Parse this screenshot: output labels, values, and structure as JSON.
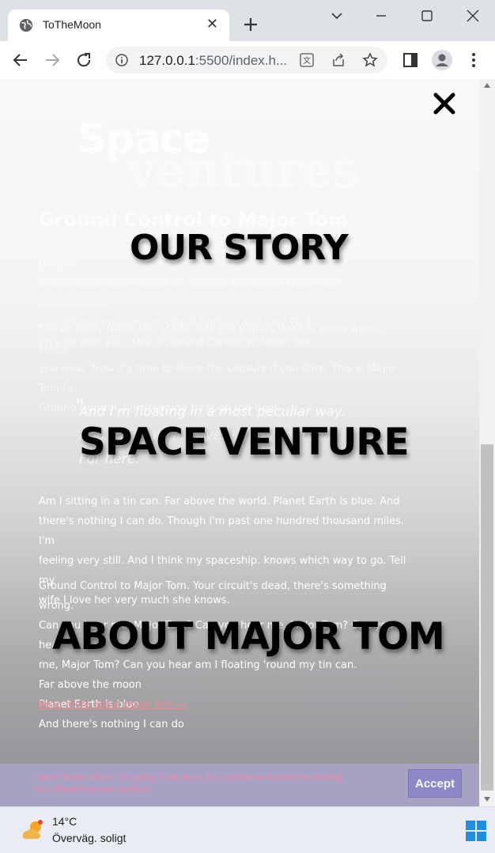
{
  "browser": {
    "tab_title": "ToTheMoon",
    "url_host": "127.0.0.1",
    "url_rest": ":5500/index.h..."
  },
  "page": {
    "logo_top": "Space",
    "logo_bottom": "ventures",
    "heading": "Ground Control to Major Tom",
    "para1_lines": [
      "Ground Control to Major Tom. Ground Control to Major Tom. Take your protein",
      "pills and put your helmet on. Ground Control to Major Tom. Commencing",
      "countdown, engines on. Check ignition and may God's",
      "love be with you. This is Ground Control to Major Tom."
    ],
    "para2_lines": [
      "You've really made the grade. And the papers want to know whose shirts",
      "you wear. Now it's time to leave the capsule if you dare. This is Major Tom to",
      "Ground Control. I'm stepping through the door."
    ],
    "quote_lines": [
      "And I'm floating in a most peculiar way.",
      "And the stars look very different today.",
      "For here."
    ],
    "para3_lines": [
      "Am I sitting in a tin can. Far above the world. Planet Earth is blue. And",
      "there's nothing I can do. Though I'm past one hundred thousand miles. I'm",
      "feeling very still. And I think my spaceship. knows which way to go. Tell my",
      "wife I love her very much she knows."
    ],
    "para4_lines": [
      "Ground Control to Major Tom. Your circuit's dead, there's something wrong.",
      "Can you hear me, Major Tom? Can you hear me, Major Tom? Can you hear",
      "me, Major Tom? Can you hear am I floating 'round my tin can.",
      "Far above the moon",
      "Planet Earth is blue",
      "And there's nothing I can do"
    ],
    "read_more": "Read more about major Tom⟶"
  },
  "menu": {
    "items": [
      "OUR STORY",
      "SPACE VENTURE",
      "ABOUT MAJOR TOM"
    ]
  },
  "cookie": {
    "line1": "I don't know where I'm going from here, but I promise it won't be boring.",
    "line2": "You should accept cookies.",
    "accept_label": "Accept"
  },
  "taskbar": {
    "temperature": "14°C",
    "condition": "Överväg. soligt"
  }
}
